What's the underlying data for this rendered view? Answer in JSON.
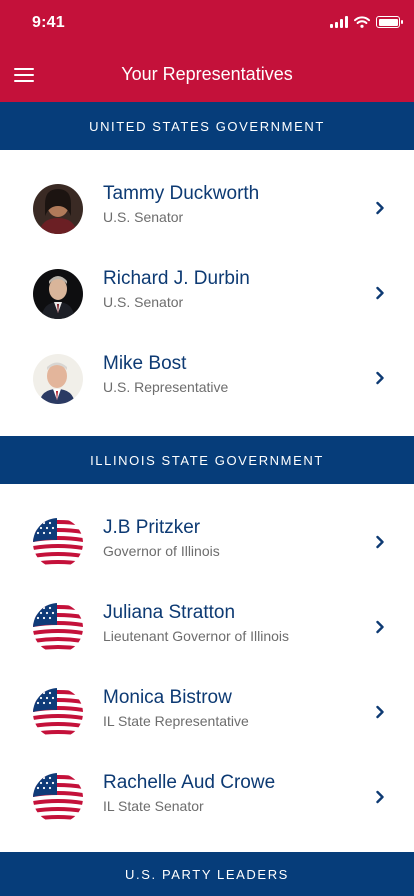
{
  "status_bar": {
    "time": "9:41"
  },
  "header": {
    "title": "Your Representatives"
  },
  "sections": [
    {
      "title": "UNITED STATES GOVERNMENT",
      "items": [
        {
          "name": "Tammy Duckworth",
          "role": "U.S. Senator",
          "avatar": "photo"
        },
        {
          "name": "Richard J. Durbin",
          "role": "U.S. Senator",
          "avatar": "photo"
        },
        {
          "name": "Mike Bost",
          "role": "U.S. Representative",
          "avatar": "photo"
        }
      ]
    },
    {
      "title": "ILLINOIS STATE GOVERNMENT",
      "items": [
        {
          "name": "J.B Pritzker",
          "role": "Governor of Illinois",
          "avatar": "us-flag"
        },
        {
          "name": "Juliana Stratton",
          "role": "Lieutenant Governor of Illinois",
          "avatar": "us-flag"
        },
        {
          "name": "Monica Bistrow",
          "role": "IL State Representative",
          "avatar": "us-flag"
        },
        {
          "name": "Rachelle Aud Crowe",
          "role": "IL State Senator",
          "avatar": "us-flag"
        }
      ]
    },
    {
      "title": "U.S. PARTY LEADERS",
      "items": []
    }
  ],
  "colors": {
    "header_red": "#c4113a",
    "section_blue": "#063d7a",
    "name_blue": "#0d3a73",
    "role_gray": "#6d6d6d"
  },
  "icons": [
    "menu-icon",
    "signal-icon",
    "wifi-icon",
    "battery-icon",
    "chevron-right-icon"
  ]
}
